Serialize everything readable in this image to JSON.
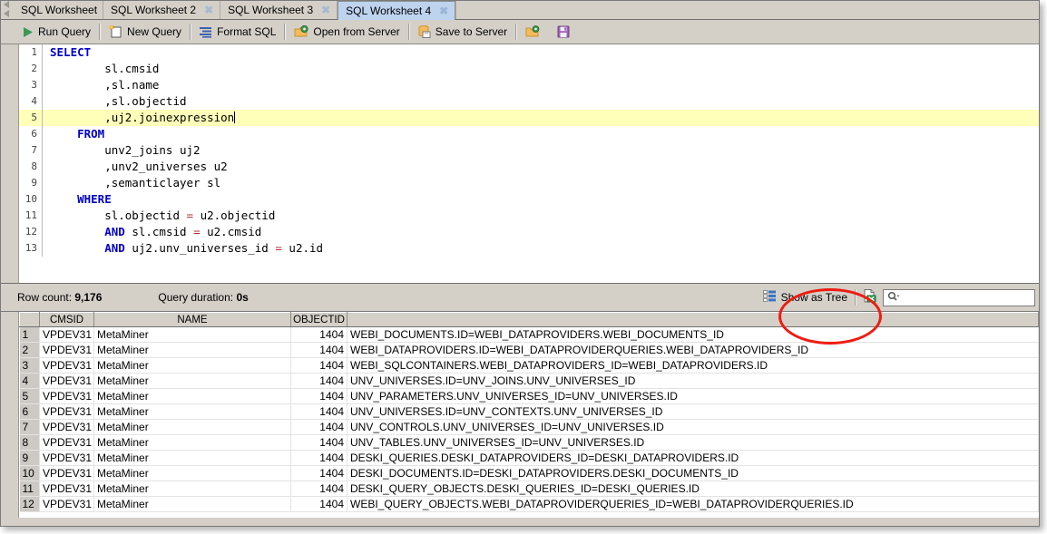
{
  "window": {
    "title": "SQL Worksheet 4"
  },
  "tabs": {
    "scroll_up_icon": "scroll-up-arrow-icon",
    "scroll_down_icon": "scroll-down-arrow-icon",
    "close_glyph": "✖",
    "items": [
      {
        "label": "SQL Worksheet",
        "active": false,
        "closable": false
      },
      {
        "label": "SQL Worksheet 2",
        "active": false,
        "closable": true
      },
      {
        "label": "SQL Worksheet 3",
        "active": false,
        "closable": true
      },
      {
        "label": "SQL Worksheet 4",
        "active": true,
        "closable": true
      }
    ]
  },
  "toolbar": {
    "run_query": "Run Query",
    "new_query": "New Query",
    "format_sql": "Format SQL",
    "open_from_server": "Open from Server",
    "save_to_server": "Save to Server",
    "icons": {
      "run": "play-triangle-icon",
      "new": "new-document-icon",
      "format": "format-lines-icon",
      "open_server": "open-folder-server-icon",
      "save_server": "database-save-icon",
      "open_file": "open-folder-icon",
      "save_file": "floppy-save-icon"
    }
  },
  "editor": {
    "lines": [
      {
        "n": "1",
        "segments": [
          {
            "t": "SELECT",
            "c": "kw"
          }
        ]
      },
      {
        "n": "2",
        "segments": [
          {
            "t": "        sl.cmsid",
            "c": ""
          }
        ]
      },
      {
        "n": "3",
        "segments": [
          {
            "t": "        ,sl.name",
            "c": ""
          }
        ]
      },
      {
        "n": "4",
        "segments": [
          {
            "t": "        ,sl.objectid",
            "c": ""
          }
        ]
      },
      {
        "n": "5",
        "segments": [
          {
            "t": "        ,uj2.joinexpression",
            "c": ""
          }
        ],
        "highlight": true,
        "caret": true
      },
      {
        "n": "6",
        "segments": [
          {
            "t": "    ",
            "c": ""
          },
          {
            "t": "FROM",
            "c": "kw"
          }
        ]
      },
      {
        "n": "7",
        "segments": [
          {
            "t": "        unv2_joins uj2",
            "c": ""
          }
        ]
      },
      {
        "n": "8",
        "segments": [
          {
            "t": "        ,unv2_universes u2",
            "c": ""
          }
        ]
      },
      {
        "n": "9",
        "segments": [
          {
            "t": "        ,semanticlayer sl",
            "c": ""
          }
        ]
      },
      {
        "n": "10",
        "segments": [
          {
            "t": "    ",
            "c": ""
          },
          {
            "t": "WHERE",
            "c": "kw"
          }
        ]
      },
      {
        "n": "11",
        "segments": [
          {
            "t": "        sl.objectid ",
            "c": ""
          },
          {
            "t": "=",
            "c": "op"
          },
          {
            "t": " u2.objectid",
            "c": ""
          }
        ]
      },
      {
        "n": "12",
        "segments": [
          {
            "t": "        ",
            "c": ""
          },
          {
            "t": "AND",
            "c": "kw"
          },
          {
            "t": " sl.cmsid ",
            "c": ""
          },
          {
            "t": "=",
            "c": "op"
          },
          {
            "t": " u2.cmsid",
            "c": ""
          }
        ]
      },
      {
        "n": "13",
        "segments": [
          {
            "t": "        ",
            "c": ""
          },
          {
            "t": "AND",
            "c": "kw"
          },
          {
            "t": " uj2.unv_universes_id ",
            "c": ""
          },
          {
            "t": "=",
            "c": "op"
          },
          {
            "t": " u2.id",
            "c": ""
          }
        ]
      }
    ]
  },
  "results_bar": {
    "row_count_label": "Row count: ",
    "row_count_value": "9,176",
    "query_duration_label": "Query duration: ",
    "query_duration_value": "0s",
    "show_as_tree": "Show as Tree",
    "show_as_tree_icon": "tree-view-icon",
    "excel_export_icon": "excel-export-icon",
    "search_icon": "search-magnifier-icon",
    "search_value": "",
    "search_placeholder": ""
  },
  "grid": {
    "columns": [
      "",
      "CMSID",
      "NAME",
      "OBJECTID",
      ""
    ],
    "rows": [
      {
        "n": "1",
        "cmsid": "VPDEV31",
        "name": "MetaMiner",
        "objectid": "1404",
        "expr": "WEBI_DOCUMENTS.ID=WEBI_DATAPROVIDERS.WEBI_DOCUMENTS_ID"
      },
      {
        "n": "2",
        "cmsid": "VPDEV31",
        "name": "MetaMiner",
        "objectid": "1404",
        "expr": "WEBI_DATAPROVIDERS.ID=WEBI_DATAPROVIDERQUERIES.WEBI_DATAPROVIDERS_ID"
      },
      {
        "n": "3",
        "cmsid": "VPDEV31",
        "name": "MetaMiner",
        "objectid": "1404",
        "expr": "WEBI_SQLCONTAINERS.WEBI_DATAPROVIDERS_ID=WEBI_DATAPROVIDERS.ID"
      },
      {
        "n": "4",
        "cmsid": "VPDEV31",
        "name": "MetaMiner",
        "objectid": "1404",
        "expr": "UNV_UNIVERSES.ID=UNV_JOINS.UNV_UNIVERSES_ID"
      },
      {
        "n": "5",
        "cmsid": "VPDEV31",
        "name": "MetaMiner",
        "objectid": "1404",
        "expr": "UNV_PARAMETERS.UNV_UNIVERSES_ID=UNV_UNIVERSES.ID"
      },
      {
        "n": "6",
        "cmsid": "VPDEV31",
        "name": "MetaMiner",
        "objectid": "1404",
        "expr": "UNV_UNIVERSES.ID=UNV_CONTEXTS.UNV_UNIVERSES_ID"
      },
      {
        "n": "7",
        "cmsid": "VPDEV31",
        "name": "MetaMiner",
        "objectid": "1404",
        "expr": "UNV_CONTROLS.UNV_UNIVERSES_ID=UNV_UNIVERSES.ID"
      },
      {
        "n": "8",
        "cmsid": "VPDEV31",
        "name": "MetaMiner",
        "objectid": "1404",
        "expr": "UNV_TABLES.UNV_UNIVERSES_ID=UNV_UNIVERSES.ID"
      },
      {
        "n": "9",
        "cmsid": "VPDEV31",
        "name": "MetaMiner",
        "objectid": "1404",
        "expr": "DESKI_QUERIES.DESKI_DATAPROVIDERS_ID=DESKI_DATAPROVIDERS.ID"
      },
      {
        "n": "10",
        "cmsid": "VPDEV31",
        "name": "MetaMiner",
        "objectid": "1404",
        "expr": "DESKI_DOCUMENTS.ID=DESKI_DATAPROVIDERS.DESKI_DOCUMENTS_ID"
      },
      {
        "n": "11",
        "cmsid": "VPDEV31",
        "name": "MetaMiner",
        "objectid": "1404",
        "expr": "DESKI_QUERY_OBJECTS.DESKI_QUERIES_ID=DESKI_QUERIES.ID"
      },
      {
        "n": "12",
        "cmsid": "VPDEV31",
        "name": "MetaMiner",
        "objectid": "1404",
        "expr": "WEBI_QUERY_OBJECTS.WEBI_DATAPROVIDERQUERIES_ID=WEBI_DATAPROVIDERQUERIES.ID"
      }
    ]
  },
  "annotation": {
    "shape": "red-ellipse-highlight",
    "color": "#ee1c12",
    "target": "Show as Tree"
  }
}
